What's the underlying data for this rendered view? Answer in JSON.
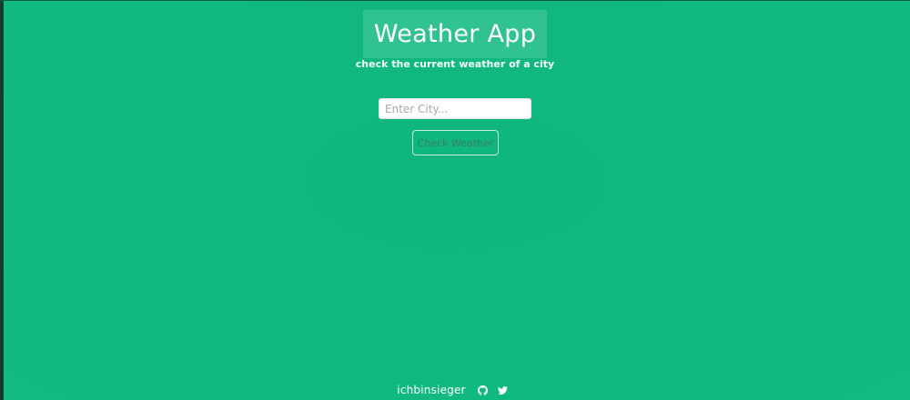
{
  "app": {
    "title": "Weather App",
    "subtitle": "check the current weather of a city"
  },
  "search": {
    "placeholder": "Enter City...",
    "value": "",
    "button_label": "Check Weather"
  },
  "footer": {
    "author": "ichbinsieger",
    "icons": [
      "github-icon",
      "twitter-icon"
    ]
  },
  "colors": {
    "background": "#10b880",
    "text": "#ffffff",
    "button_text": "#3d7a61"
  }
}
